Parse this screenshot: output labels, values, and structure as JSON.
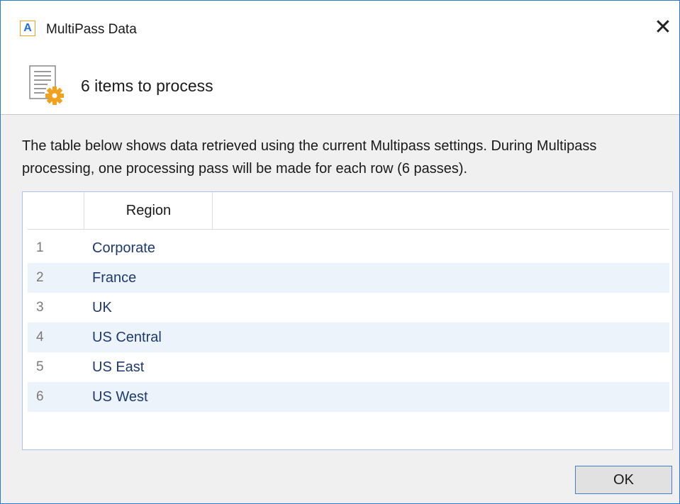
{
  "window": {
    "title": "MultiPass Data",
    "app_icon_letter": "A",
    "close_glyph": "✕"
  },
  "header": {
    "title": "6 items to process",
    "icon": "document-gear-icon"
  },
  "description": "The table below shows data retrieved using the current Multipass settings. During Multipass processing, one processing pass will be made for each row (6 passes).",
  "table": {
    "columns": [
      "",
      "Region"
    ],
    "rows": [
      {
        "index": "1",
        "region": "Corporate"
      },
      {
        "index": "2",
        "region": "France"
      },
      {
        "index": "3",
        "region": "UK"
      },
      {
        "index": "4",
        "region": "US Central"
      },
      {
        "index": "5",
        "region": "US East"
      },
      {
        "index": "6",
        "region": "US West"
      }
    ]
  },
  "buttons": {
    "ok_label": "OK"
  },
  "colors": {
    "accent": "#2b79d4",
    "row_alt": "#edf3fb",
    "gear": "#f0a21c"
  }
}
